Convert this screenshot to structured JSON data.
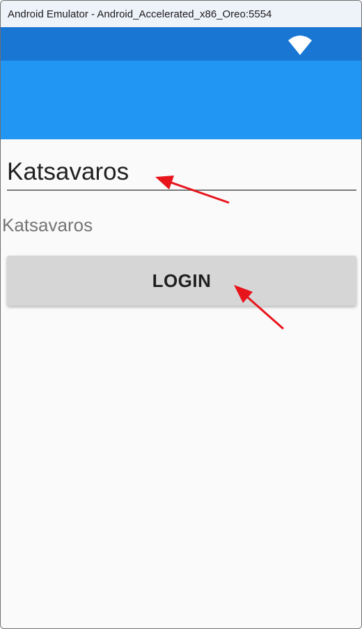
{
  "window": {
    "title": "Android Emulator - Android_Accelerated_x86_Oreo:5554"
  },
  "status_bar": {
    "icons": [
      "wifi-icon"
    ],
    "color": "#1976d2"
  },
  "app_bar": {
    "color": "#2196f3"
  },
  "form": {
    "entry_value": "Katsavaros",
    "echo_label": "Katsavaros",
    "login_label": "LOGIN"
  },
  "annotations": {
    "arrow_color": "#e8141b",
    "arrows": [
      "arrow-to-entry",
      "arrow-to-login-button"
    ]
  }
}
